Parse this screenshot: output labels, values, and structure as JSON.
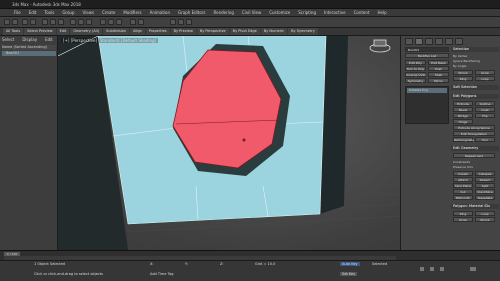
{
  "window": {
    "title": "3ds Max - Autodesk 3ds Max 2018"
  },
  "menu": [
    "File",
    "Edit",
    "Tools",
    "Group",
    "Views",
    "Create",
    "Modifiers",
    "Animation",
    "Graph Editors",
    "Rendering",
    "Civil View",
    "Customize",
    "Scripting",
    "Interactive",
    "Content",
    "Help"
  ],
  "ribbon": [
    "All Tools",
    "Select Preview",
    "Edit",
    "Geometry (All)",
    "Subdivision",
    "Align",
    "Properties",
    "By Preview",
    "By Perspective",
    "By Pivot Edge",
    "By Numeric",
    "By Symmetry"
  ],
  "left": {
    "tabs": [
      "Select",
      "Display",
      "Edit"
    ],
    "header": "Name (Sorted Ascending)",
    "items": [
      "Box001"
    ]
  },
  "viewport": {
    "label": "[+] [Perspective] [Standard] [Default Shading]"
  },
  "right": {
    "object_name": "Box001",
    "modifier_list": "Modifier List",
    "modifier_stack": [
      "Editable Poly"
    ],
    "sections": [
      "Selection",
      "Soft Selection",
      "Edit Polygons",
      "Edit Geometry",
      "Polygon: Material IDs"
    ],
    "buttons_left": [
      "Extrude",
      "Outline",
      "Bevel",
      "Inset",
      "Bridge",
      "Flip",
      "Hinge",
      "Extrude Along Spline",
      "Edit Triangulation",
      "Retriangulate",
      "Turn"
    ],
    "buttons_right": [
      "Edit Poly",
      "Edit Mesh",
      "Turn to Poly",
      "Push",
      "Unwrap UVW",
      "Shell",
      "Symmetry",
      "Mirror",
      "Ring",
      "Loop",
      "Grow",
      "Shrink"
    ],
    "checkboxes": [
      "By Vertex",
      "Ignore Backfacing",
      "By Angle",
      "Shrink",
      "Grow",
      "Ring",
      "Loop"
    ],
    "edit_geom": [
      "Repeat Last",
      "Constraints",
      "Preserve UVs",
      "Create",
      "Collapse",
      "Attach",
      "Detach",
      "Slice Plane",
      "Split",
      "Cut",
      "QuickSlice",
      "MSmooth",
      "Tessellate"
    ]
  },
  "timeline": {
    "frame": "0 / 100"
  },
  "status": {
    "message": "1 Object Selected",
    "hint": "Click or click-and-drag to select objects",
    "x": "X:",
    "y": "Y:",
    "z": "Z:",
    "grid": "Grid = 10.0",
    "autokey": "Auto Key",
    "setkey": "Set Key",
    "selected": "Selected",
    "add_time_tag": "Add Time Tag"
  },
  "colors": {
    "box": "#9bd4de",
    "polygon": "#f05a6a",
    "interior": "#2a3c3e"
  }
}
